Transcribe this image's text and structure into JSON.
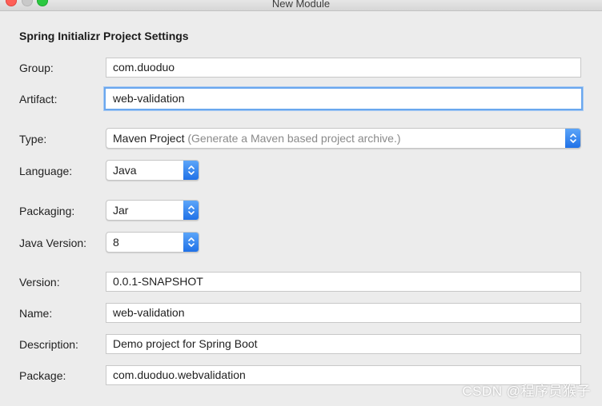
{
  "window": {
    "title": "New Module"
  },
  "section": {
    "title": "Spring Initializr Project Settings"
  },
  "form": {
    "group": {
      "label": "Group:",
      "value": "com.duoduo"
    },
    "artifact": {
      "label": "Artifact:",
      "value": "web-validation"
    },
    "type": {
      "label": "Type:",
      "value": "Maven Project",
      "hint": "(Generate a Maven based project archive.)"
    },
    "language": {
      "label": "Language:",
      "value": "Java"
    },
    "packaging": {
      "label": "Packaging:",
      "value": "Jar"
    },
    "java_version": {
      "label": "Java Version:",
      "value": "8"
    },
    "version": {
      "label": "Version:",
      "value": "0.0.1-SNAPSHOT"
    },
    "name": {
      "label": "Name:",
      "value": "web-validation"
    },
    "description": {
      "label": "Description:",
      "value": "Demo project for Spring Boot"
    },
    "package": {
      "label": "Package:",
      "value": "com.duoduo.webvalidation"
    }
  },
  "icons": {
    "close": "close-window-icon",
    "minimize": "minimize-window-icon",
    "maximize": "maximize-window-icon",
    "stepper": "up-down-chevron-icon"
  },
  "colors": {
    "close": "#fe5f57",
    "maximize": "#2bc840",
    "accent": "#1d6fe6",
    "focus": "#6aa7ee"
  },
  "watermark": {
    "text": "CSDN @程序员猴子"
  }
}
